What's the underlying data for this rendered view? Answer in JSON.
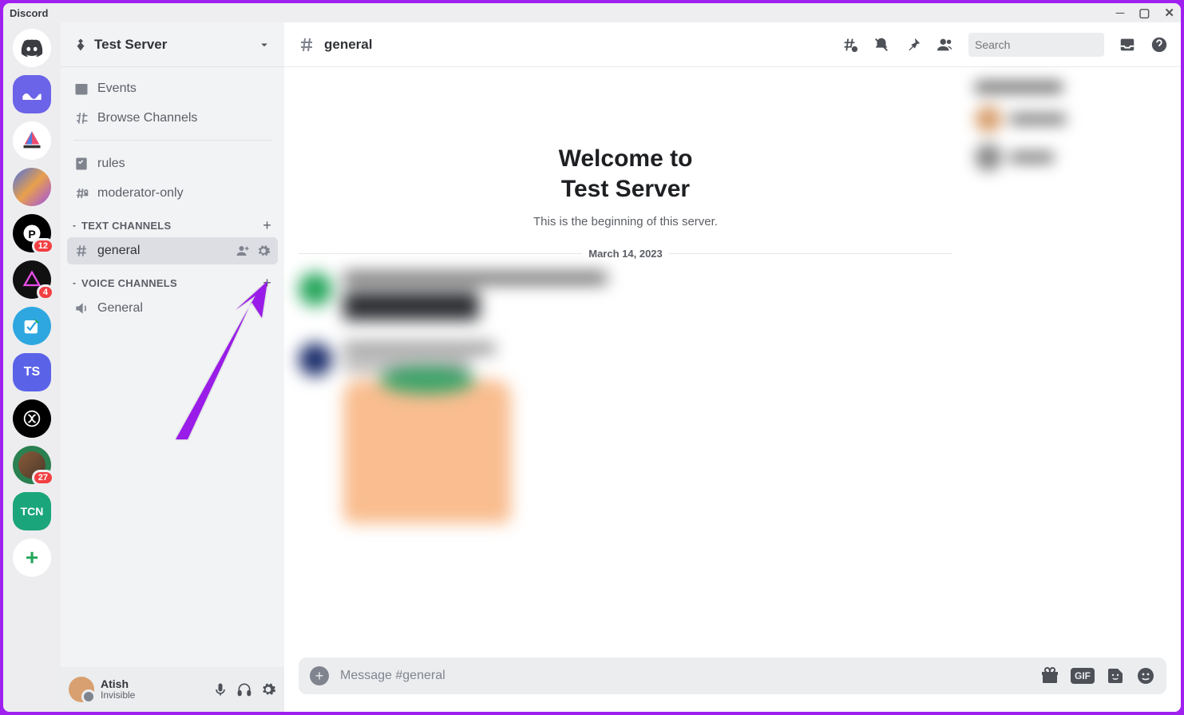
{
  "app_title": "Discord",
  "server_rail": {
    "badges": {
      "s4": "12",
      "s5": "4",
      "s9": "27"
    }
  },
  "sidebar": {
    "server_name": "Test Server",
    "top_items": {
      "events": "Events",
      "browse": "Browse Channels"
    },
    "pinned": {
      "rules": "rules",
      "moderator": "moderator-only"
    },
    "categories": {
      "text": {
        "label": "TEXT CHANNELS",
        "channels": {
          "general": "general"
        }
      },
      "voice": {
        "label": "VOICE CHANNELS",
        "channels": {
          "general": "General"
        }
      }
    }
  },
  "user_panel": {
    "name": "Atish",
    "status": "Invisible"
  },
  "chat": {
    "header": {
      "channel_name": "general",
      "search_placeholder": "Search"
    },
    "welcome": {
      "title_line1": "Welcome to",
      "title_line2": "Test Server",
      "subtitle": "This is the beginning of this server."
    },
    "date_divider": "March 14, 2023",
    "input_placeholder": "Message #general",
    "gif_label": "GIF"
  }
}
